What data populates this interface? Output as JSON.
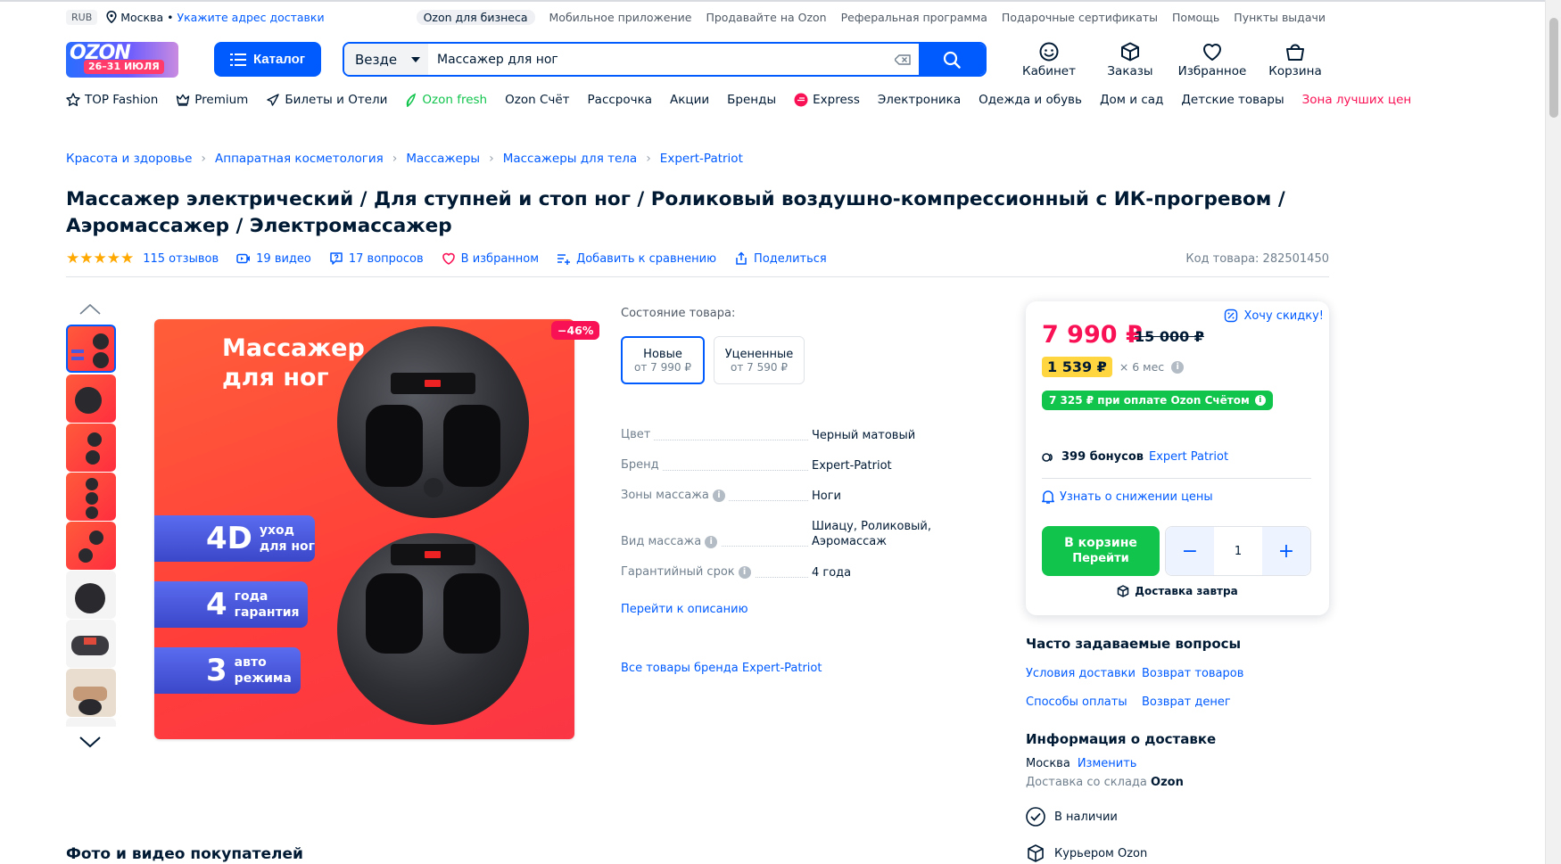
{
  "topbar": {
    "currency": "RUB",
    "city": "Москва",
    "address_link": "Укажите адрес доставки",
    "links": [
      "Ozon для бизнеса",
      "Мобильное приложение",
      "Продавайте на Ozon",
      "Реферальная программа",
      "Подарочные сертификаты",
      "Помощь",
      "Пункты выдачи"
    ]
  },
  "header": {
    "logo_text": "OZON",
    "logo_promo": "26–31 ИЮЛЯ",
    "catalog_label": "Каталог",
    "search_scope": "Везде",
    "search_value": "Массажер для ног",
    "icons": [
      {
        "label": "Кабинет",
        "icon": "user-icon"
      },
      {
        "label": "Заказы",
        "icon": "box-icon"
      },
      {
        "label": "Избранное",
        "icon": "heart-icon"
      },
      {
        "label": "Корзина",
        "icon": "cart-icon"
      }
    ]
  },
  "categories": [
    "TOP Fashion",
    "Premium",
    "Билеты и Отели",
    "Ozon fresh",
    "Ozon Счёт",
    "Рассрочка",
    "Акции",
    "Бренды",
    "Express",
    "Электроника",
    "Одежда и обувь",
    "Дом и сад",
    "Детские товары",
    "Зона лучших цен"
  ],
  "breadcrumbs": [
    "Красота и здоровье",
    "Аппаратная косметология",
    "Массажеры",
    "Массажеры для тела",
    "Expert-Patriot"
  ],
  "product": {
    "title": "Массажер электрический / Для ступней и стоп ног / Роликовый воздушно-компрессионный с ИК-прогревом / Аэромассажер / Электромассажер",
    "stars": "★★★★★",
    "reviews": "115 отзывов",
    "videos": "19 видео",
    "questions": "17 вопросов",
    "favorite": "В избранном",
    "compare": "Добавить к сравнению",
    "share": "Поделиться",
    "sku": "Код товара: 282501450",
    "discount_badge": "−46%",
    "image": {
      "headline_1": "Массажер",
      "headline_2": "для ног",
      "pills": [
        {
          "big": "4D",
          "small_1": "уход",
          "small_2": "для ног"
        },
        {
          "big": "4",
          "small_1": "года",
          "small_2": "гарантия"
        },
        {
          "big": "3",
          "small_1": "авто",
          "small_2": "режима"
        }
      ]
    }
  },
  "condition": {
    "label": "Состояние товара:",
    "new_title": "Новые",
    "new_price": "от 7 990 ₽",
    "used_title": "Уцененные",
    "used_price": "от 7 590 ₽"
  },
  "specs": [
    {
      "key": "Цвет",
      "value": "Черный матовый",
      "link": false,
      "info": false
    },
    {
      "key": "Бренд",
      "value": "Expert-Patriot",
      "link": true,
      "info": false
    },
    {
      "key": "Зоны массажа",
      "value": "Ноги",
      "link": false,
      "info": true
    },
    {
      "key": "Вид массажа",
      "value": "Шиацу, Роликовый, Аэромассаж",
      "link": false,
      "info": true
    },
    {
      "key": "Гарантийный срок",
      "value": "4 года",
      "link": false,
      "info": true
    }
  ],
  "to_description": "Перейти к описанию",
  "all_brand": "Все товары бренда Expert-Patriot",
  "price_card": {
    "price": "7 990 ₽",
    "old_price": "15 000 ₽",
    "want_discount": "Хочу скидку!",
    "installment_amount": "1 539 ₽",
    "installment_term": "× 6 мес",
    "ozon_card_price": "7 325 ₽ при оплате Ozon Счётом",
    "bonus_amount": "399 бонусов",
    "bonus_brand": "Expert Patriot",
    "notify": "Узнать о снижении цены",
    "in_cart": "В корзине",
    "go": "Перейти",
    "quantity": "1",
    "minus": "−",
    "plus": "+",
    "delivery": "Доставка завтра"
  },
  "faq": {
    "title": "Часто задаваемые вопросы",
    "links": [
      "Условия доставки",
      "Возврат товаров",
      "Способы оплаты",
      "Возврат денег"
    ]
  },
  "delivery_info": {
    "title": "Информация о доставке",
    "city": "Москва",
    "change": "Изменить",
    "warehouse_prefix": "Доставка со склада",
    "warehouse_name": "Ozon",
    "in_stock": "В наличии",
    "courier": "Курьером Ozon"
  },
  "photos_title": "Фото и видео покупателей",
  "colors": {
    "accent": "#005bff",
    "price": "#f91155",
    "green": "#10c44c",
    "star": "#ffa800",
    "installment_bg": "#ffd540"
  }
}
